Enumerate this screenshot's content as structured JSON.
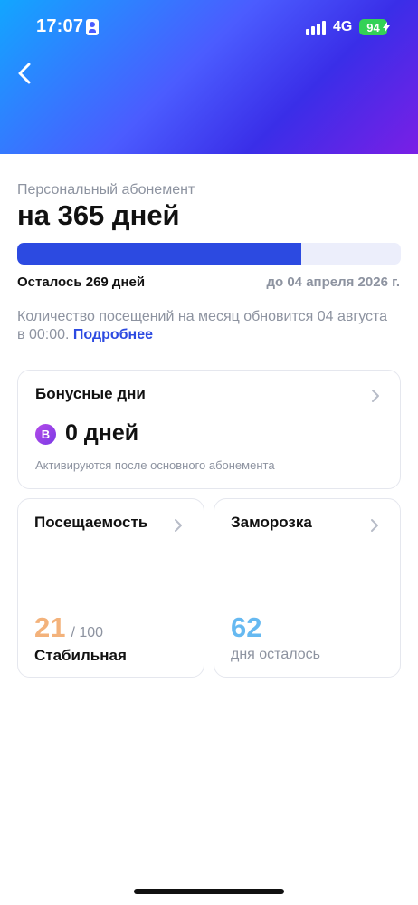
{
  "status_bar": {
    "time": "17:07",
    "network": "4G",
    "battery": "94"
  },
  "subscription": {
    "label": "Персональный абонемент",
    "title": "на 365 дней",
    "remaining": "Осталось 269 дней",
    "until": "до 04 апреля 2026 г.",
    "progress_fraction": 0.74,
    "info_text": "Количество посещений на месяц обновится 04 августа в 00:00.",
    "more_link": "Подробнее"
  },
  "bonus_card": {
    "title": "Бонусные дни",
    "badge": "B",
    "value": "0 дней",
    "note": "Активируются после основного абонемента"
  },
  "attendance_card": {
    "title": "Посещаемость",
    "value": "21",
    "total": "/ 100",
    "status": "Стабильная"
  },
  "freeze_card": {
    "title": "Заморозка",
    "value": "62",
    "note": "дня осталось"
  },
  "icons": {
    "back": "chevron-left-icon",
    "chevron": "chevron-right-icon",
    "profile": "id-card-icon",
    "signal": "signal-icon",
    "battery": "battery-icon"
  },
  "colors": {
    "accent": "#2c4ae1",
    "attendance_value": "#f3b27b",
    "freeze_value": "#66b9f1",
    "bonus_badge": "#9b42e7"
  }
}
